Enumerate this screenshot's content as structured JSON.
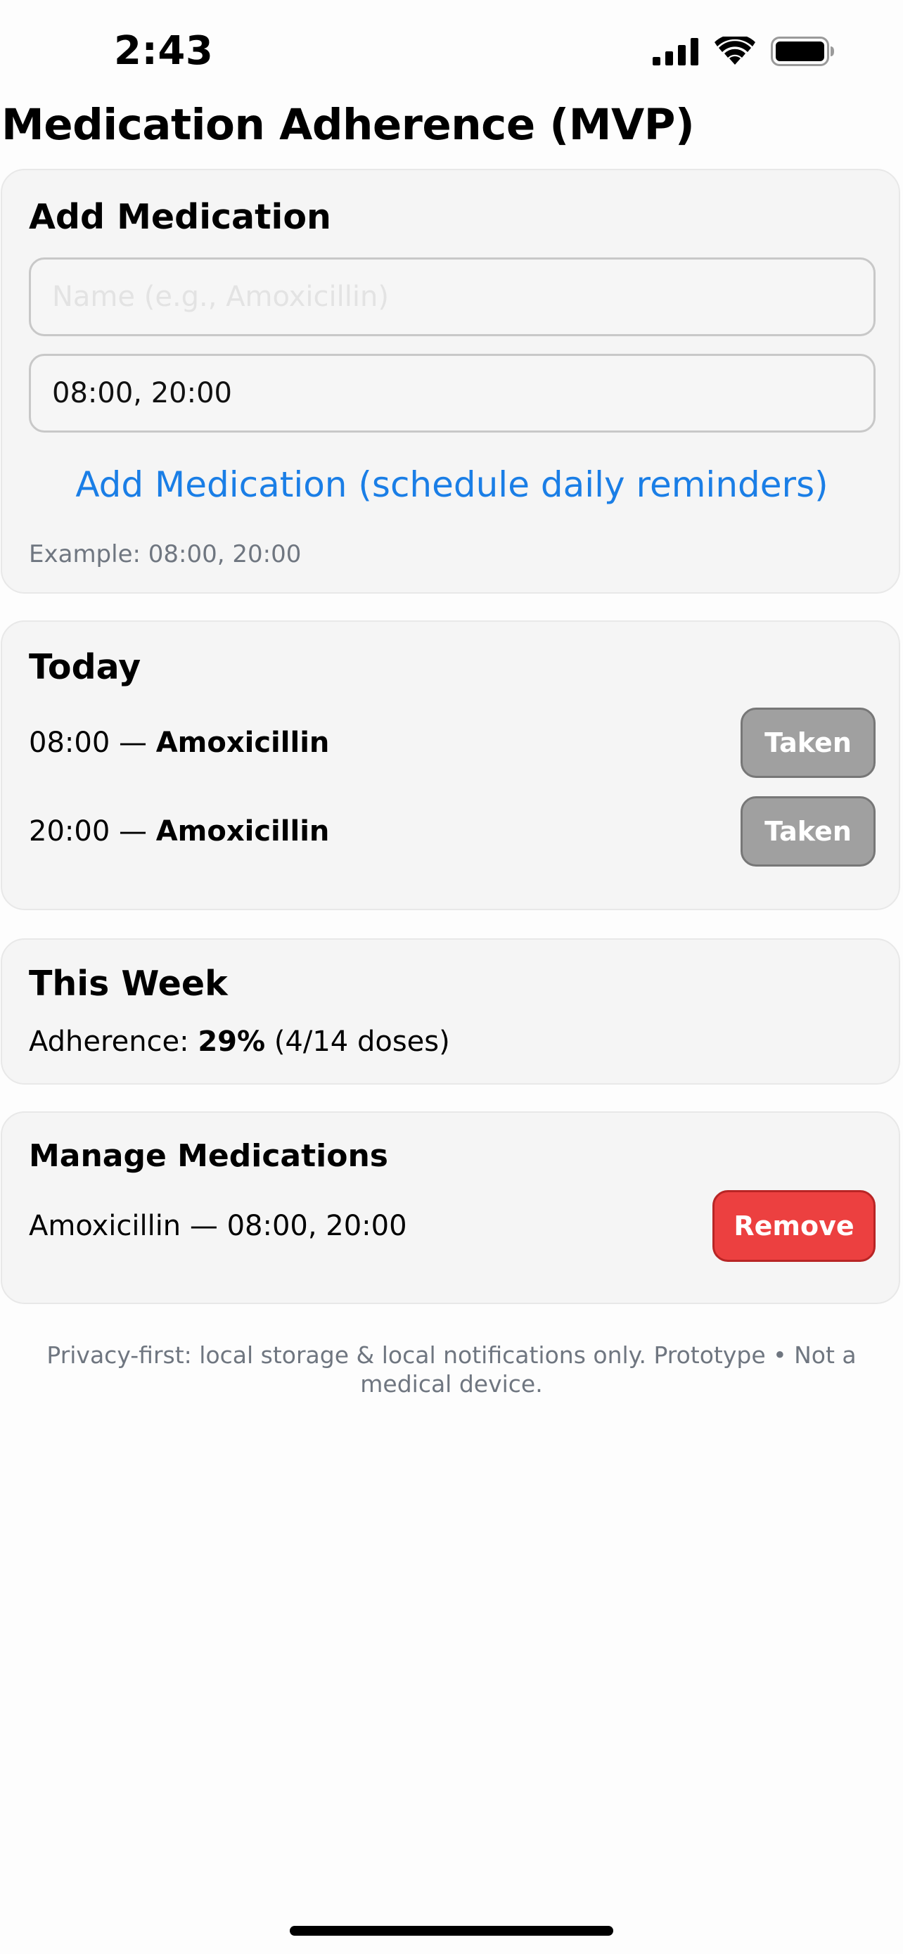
{
  "status_bar": {
    "time": "2:43",
    "icons": [
      "cellular-signal-icon",
      "wifi-icon",
      "battery-icon"
    ]
  },
  "page": {
    "title": "Medication Adherence (MVP)"
  },
  "add_medication": {
    "title": "Add Medication",
    "name_placeholder": "Name (e.g., Amoxicillin)",
    "name_value": "",
    "times_value": "08:00, 20:00",
    "add_button_label": "Add Medication (schedule daily reminders)",
    "helper_text": "Example: 08:00, 20:00"
  },
  "today": {
    "title": "Today",
    "separator": "—",
    "doses": [
      {
        "time": "08:00",
        "medication": "Amoxicillin",
        "button_label": "Taken"
      },
      {
        "time": "20:00",
        "medication": "Amoxicillin",
        "button_label": "Taken"
      }
    ]
  },
  "this_week": {
    "title": "This Week",
    "adherence_label": "Adherence:",
    "adherence_percent": "29%",
    "adherence_detail": "(4/14 doses)"
  },
  "manage": {
    "title": "Manage Medications",
    "items": [
      {
        "label": "Amoxicillin — 08:00, 20:00",
        "button_label": "Remove"
      }
    ]
  },
  "footer": {
    "note": "Privacy-first: local storage & local notifications only. Prototype • Not a medical device."
  },
  "colors": {
    "accent_link": "#1a7ee6",
    "card_background": "#f5f5f5",
    "taken_button": "#a0a0a0",
    "remove_button": "#ec4040",
    "muted_text": "#6f7680"
  }
}
